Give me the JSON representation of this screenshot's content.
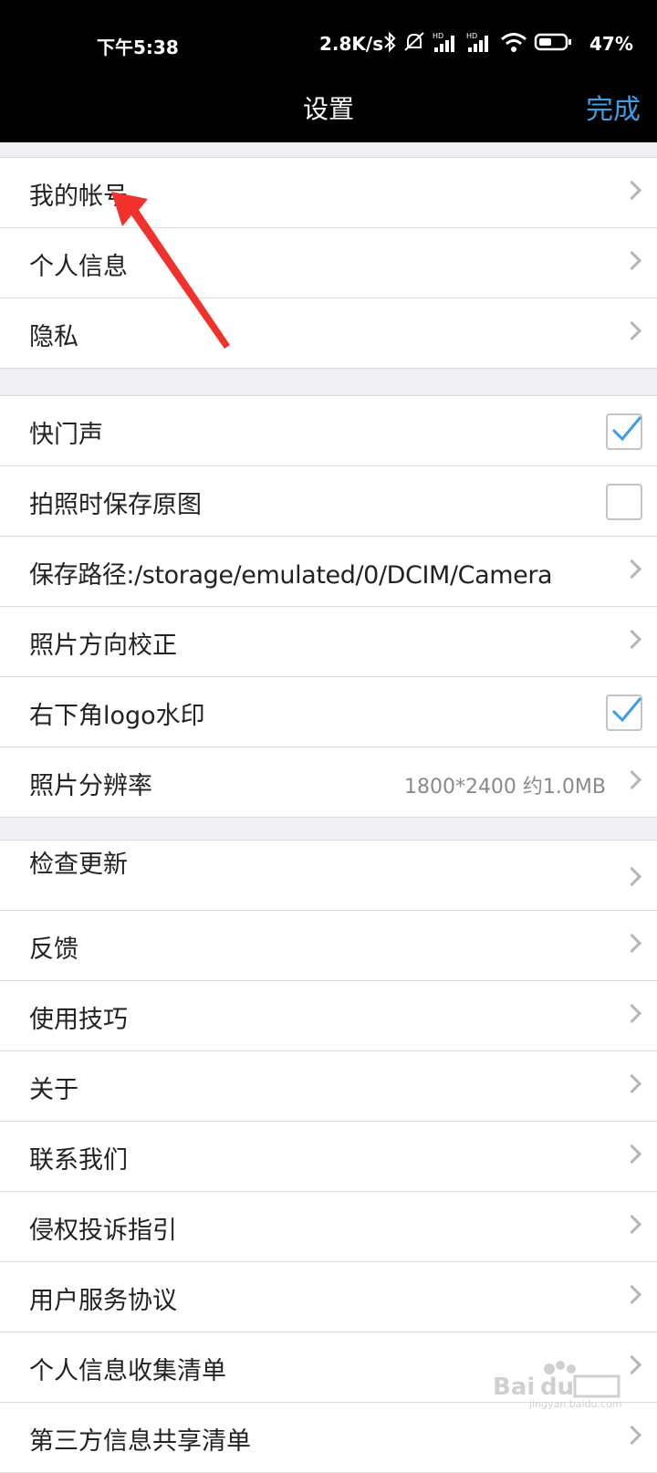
{
  "status_bar": {
    "time": "下午5:38",
    "net_speed": "2.8K/s",
    "battery": "47%",
    "icons": [
      "bluetooth-icon",
      "mute-icon",
      "signal-hd-icon",
      "signal-hd-icon",
      "wifi-icon",
      "battery-icon"
    ]
  },
  "header": {
    "title": "设置",
    "done_label": "完成"
  },
  "groups": [
    {
      "rows": [
        {
          "label": "我的帐号",
          "control": "chevron"
        },
        {
          "label": "个人信息",
          "control": "chevron"
        },
        {
          "label": "隐私",
          "control": "chevron"
        }
      ]
    },
    {
      "rows": [
        {
          "label": "快门声",
          "control": "checkbox",
          "checked": true
        },
        {
          "label": "拍照时保存原图",
          "control": "checkbox",
          "checked": false
        },
        {
          "label": "保存路径:/storage/emulated/0/DCIM/Camera",
          "control": "chevron"
        },
        {
          "label": "照片方向校正",
          "control": "chevron"
        },
        {
          "label": "右下角logo水印",
          "control": "checkbox",
          "checked": true
        },
        {
          "label": "照片分辨率",
          "value": "1800*2400 约1.0MB",
          "control": "chevron"
        }
      ]
    },
    {
      "rows": [
        {
          "label": "检查更新",
          "control": "chevron"
        },
        {
          "label": "反馈",
          "control": "chevron"
        },
        {
          "label": "使用技巧",
          "control": "chevron"
        },
        {
          "label": "关于",
          "control": "chevron"
        },
        {
          "label": "联系我们",
          "control": "chevron"
        },
        {
          "label": "侵权投诉指引",
          "control": "chevron"
        },
        {
          "label": "用户服务协议",
          "control": "chevron"
        },
        {
          "label": "个人信息收集清单",
          "control": "chevron"
        },
        {
          "label": "第三方信息共享清单",
          "control": "chevron"
        }
      ]
    }
  ],
  "colors": {
    "accent": "#3a9fe6",
    "checkmark": "#3a9fe6",
    "annotation_arrow": "#f0312c"
  }
}
